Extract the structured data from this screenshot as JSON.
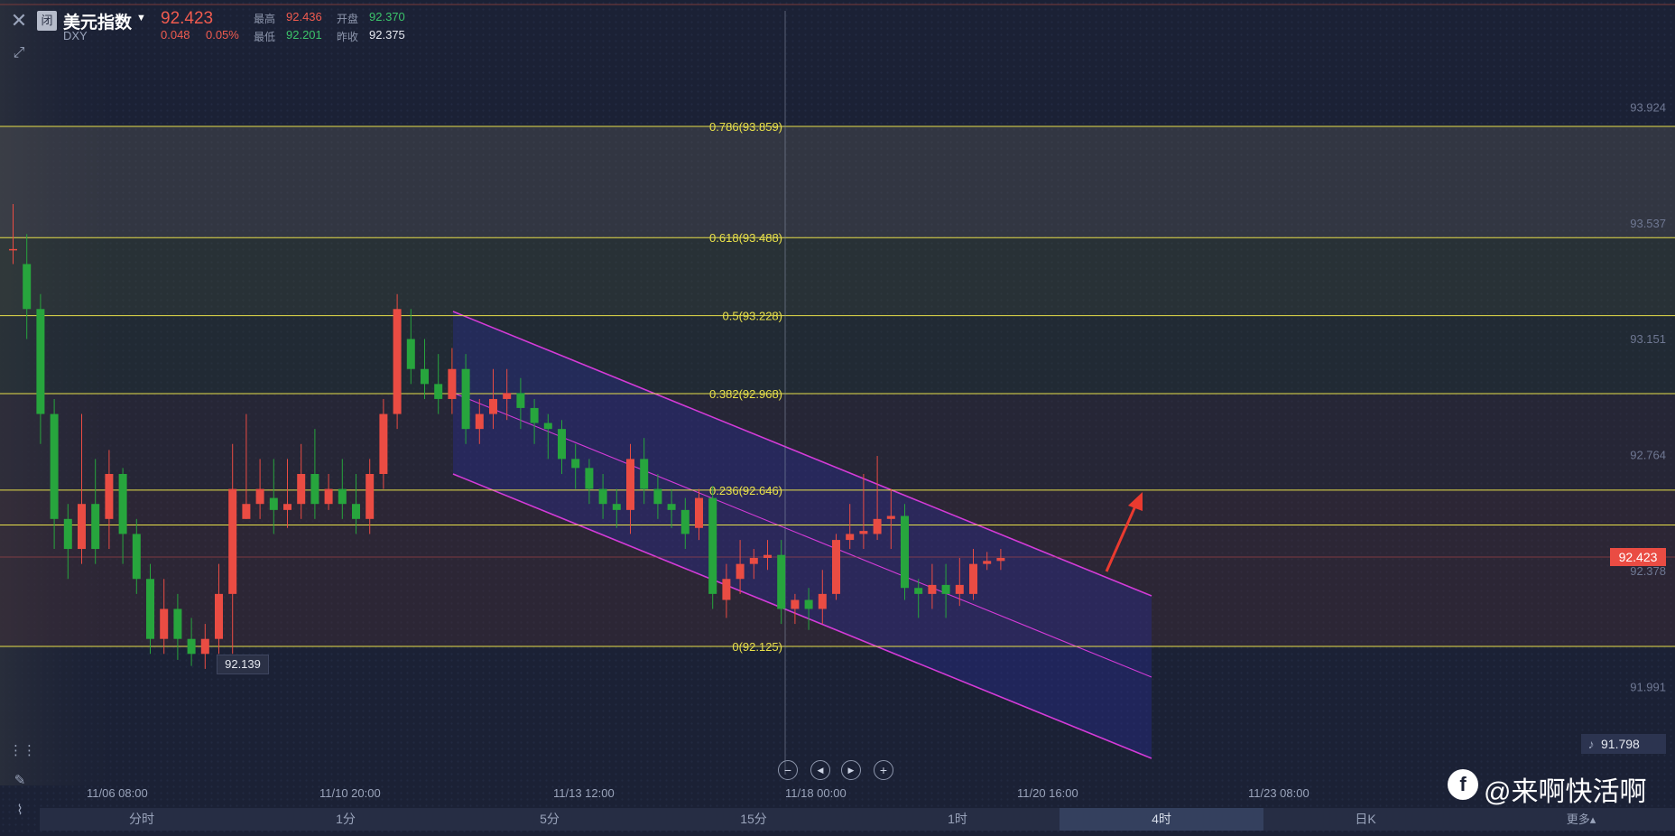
{
  "header": {
    "closed_badge": "闭",
    "instrument_name": "美元指数",
    "instrument_code": "DXY",
    "last_price": "92.423",
    "change": "0.048",
    "change_pct": "0.05%",
    "high_label": "最高",
    "high_value": "92.436",
    "low_label": "最低",
    "low_value": "92.201",
    "open_label": "开盘",
    "open_value": "92.370",
    "prev_close_label": "昨收",
    "prev_close_value": "92.375"
  },
  "colors": {
    "up": "#ea4c43",
    "down": "#27a53d",
    "fib_line": "#e8e04a",
    "channel": "#d43bd8",
    "background": "#1b2135"
  },
  "price_axis_labels": [
    "93.924",
    "93.537",
    "93.151",
    "92.764",
    "92.378",
    "91.991"
  ],
  "current_price_badge": "92.423",
  "alert_price": "91.798",
  "low_marker": "92.139",
  "time_labels": [
    "11/06 08:00",
    "11/10 20:00",
    "11/13 12:00",
    "11/18 00:00",
    "11/20 16:00",
    "11/23 08:00"
  ],
  "zoom_controls": {
    "zoom_out": "−",
    "step_back": "◀",
    "step_forward": "▶",
    "zoom_in": "+"
  },
  "periods": [
    "分时",
    "1分",
    "5分",
    "15分",
    "1时",
    "4时",
    "日K"
  ],
  "active_period": "4时",
  "more_label": "更多▴",
  "watermark": {
    "logo": "f",
    "text": "@来啊快活啊"
  },
  "chart_data": {
    "type": "candlestick",
    "fib_levels": [
      {
        "label": "0.786(93.859)",
        "value": 93.859
      },
      {
        "label": "0.618(93.488)",
        "value": 93.488
      },
      {
        "label": "0.5(93.228)",
        "value": 93.228
      },
      {
        "label": "0.382(92.968)",
        "value": 92.968
      },
      {
        "label": "0.236(92.646)",
        "value": 92.646
      },
      {
        "label": "0(92.125)",
        "value": 92.125
      }
    ],
    "extra_hline": 92.53,
    "y_range": [
      91.65,
      94.3
    ],
    "candles": [
      [
        93.45,
        93.45,
        93.6,
        93.4
      ],
      [
        93.4,
        93.25,
        93.5,
        93.15
      ],
      [
        93.25,
        92.9,
        93.3,
        92.8
      ],
      [
        92.9,
        92.55,
        92.95,
        92.45
      ],
      [
        92.55,
        92.45,
        92.6,
        92.35
      ],
      [
        92.45,
        92.6,
        92.9,
        92.4
      ],
      [
        92.6,
        92.45,
        92.75,
        92.4
      ],
      [
        92.55,
        92.7,
        92.78,
        92.45
      ],
      [
        92.7,
        92.5,
        92.72,
        92.4
      ],
      [
        92.5,
        92.35,
        92.55,
        92.3
      ],
      [
        92.35,
        92.15,
        92.4,
        92.1
      ],
      [
        92.15,
        92.25,
        92.35,
        92.1
      ],
      [
        92.25,
        92.15,
        92.3,
        92.08
      ],
      [
        92.15,
        92.1,
        92.22,
        92.06
      ],
      [
        92.1,
        92.15,
        92.2,
        92.05
      ],
      [
        92.15,
        92.3,
        92.4,
        92.1
      ],
      [
        92.3,
        92.65,
        92.8,
        92.1
      ],
      [
        92.55,
        92.6,
        92.9,
        92.55
      ],
      [
        92.6,
        92.65,
        92.75,
        92.55
      ],
      [
        92.62,
        92.58,
        92.75,
        92.5
      ],
      [
        92.58,
        92.6,
        92.75,
        92.52
      ],
      [
        92.6,
        92.7,
        92.8,
        92.55
      ],
      [
        92.7,
        92.6,
        92.85,
        92.55
      ],
      [
        92.6,
        92.65,
        92.7,
        92.58
      ],
      [
        92.65,
        92.6,
        92.75,
        92.55
      ],
      [
        92.6,
        92.55,
        92.7,
        92.5
      ],
      [
        92.55,
        92.7,
        92.75,
        92.5
      ],
      [
        92.7,
        92.9,
        92.95,
        92.65
      ],
      [
        92.9,
        93.25,
        93.3,
        92.85
      ],
      [
        93.15,
        93.05,
        93.25,
        93.0
      ],
      [
        93.05,
        93.0,
        93.15,
        92.95
      ],
      [
        93.0,
        92.95,
        93.1,
        92.9
      ],
      [
        92.95,
        93.05,
        93.12,
        92.9
      ],
      [
        93.05,
        92.85,
        93.1,
        92.8
      ],
      [
        92.85,
        92.9,
        92.95,
        92.8
      ],
      [
        92.9,
        92.95,
        93.05,
        92.85
      ],
      [
        92.95,
        92.97,
        93.05,
        92.88
      ],
      [
        92.97,
        92.92,
        93.02,
        92.85
      ],
      [
        92.92,
        92.87,
        92.95,
        92.8
      ],
      [
        92.87,
        92.85,
        92.9,
        92.75
      ],
      [
        92.85,
        92.75,
        92.88,
        92.7
      ],
      [
        92.75,
        92.72,
        92.8,
        92.65
      ],
      [
        92.72,
        92.65,
        92.75,
        92.6
      ],
      [
        92.65,
        92.6,
        92.7,
        92.55
      ],
      [
        92.6,
        92.58,
        92.65,
        92.52
      ],
      [
        92.58,
        92.75,
        92.8,
        92.5
      ],
      [
        92.75,
        92.65,
        92.82,
        92.6
      ],
      [
        92.65,
        92.6,
        92.7,
        92.55
      ],
      [
        92.6,
        92.58,
        92.65,
        92.52
      ],
      [
        92.58,
        92.5,
        92.62,
        92.45
      ],
      [
        92.52,
        92.62,
        92.65,
        92.48
      ],
      [
        92.62,
        92.3,
        92.66,
        92.25
      ],
      [
        92.28,
        92.35,
        92.4,
        92.22
      ],
      [
        92.35,
        92.4,
        92.48,
        92.3
      ],
      [
        92.4,
        92.42,
        92.45,
        92.35
      ],
      [
        92.42,
        92.43,
        92.48,
        92.38
      ],
      [
        92.43,
        92.25,
        92.48,
        92.2
      ],
      [
        92.25,
        92.28,
        92.3,
        92.2
      ],
      [
        92.28,
        92.25,
        92.32,
        92.18
      ],
      [
        92.25,
        92.3,
        92.38,
        92.2
      ],
      [
        92.3,
        92.48,
        92.5,
        92.28
      ],
      [
        92.48,
        92.5,
        92.6,
        92.45
      ],
      [
        92.5,
        92.51,
        92.7,
        92.45
      ],
      [
        92.5,
        92.55,
        92.76,
        92.48
      ],
      [
        92.55,
        92.56,
        92.65,
        92.45
      ],
      [
        92.56,
        92.32,
        92.6,
        92.28
      ],
      [
        92.32,
        92.3,
        92.35,
        92.22
      ],
      [
        92.3,
        92.33,
        92.4,
        92.25
      ],
      [
        92.33,
        92.3,
        92.4,
        92.22
      ],
      [
        92.3,
        92.33,
        92.42,
        92.26
      ],
      [
        92.3,
        92.4,
        92.45,
        92.28
      ],
      [
        92.4,
        92.41,
        92.44,
        92.38
      ],
      [
        92.41,
        92.42,
        92.45,
        92.38
      ]
    ]
  }
}
